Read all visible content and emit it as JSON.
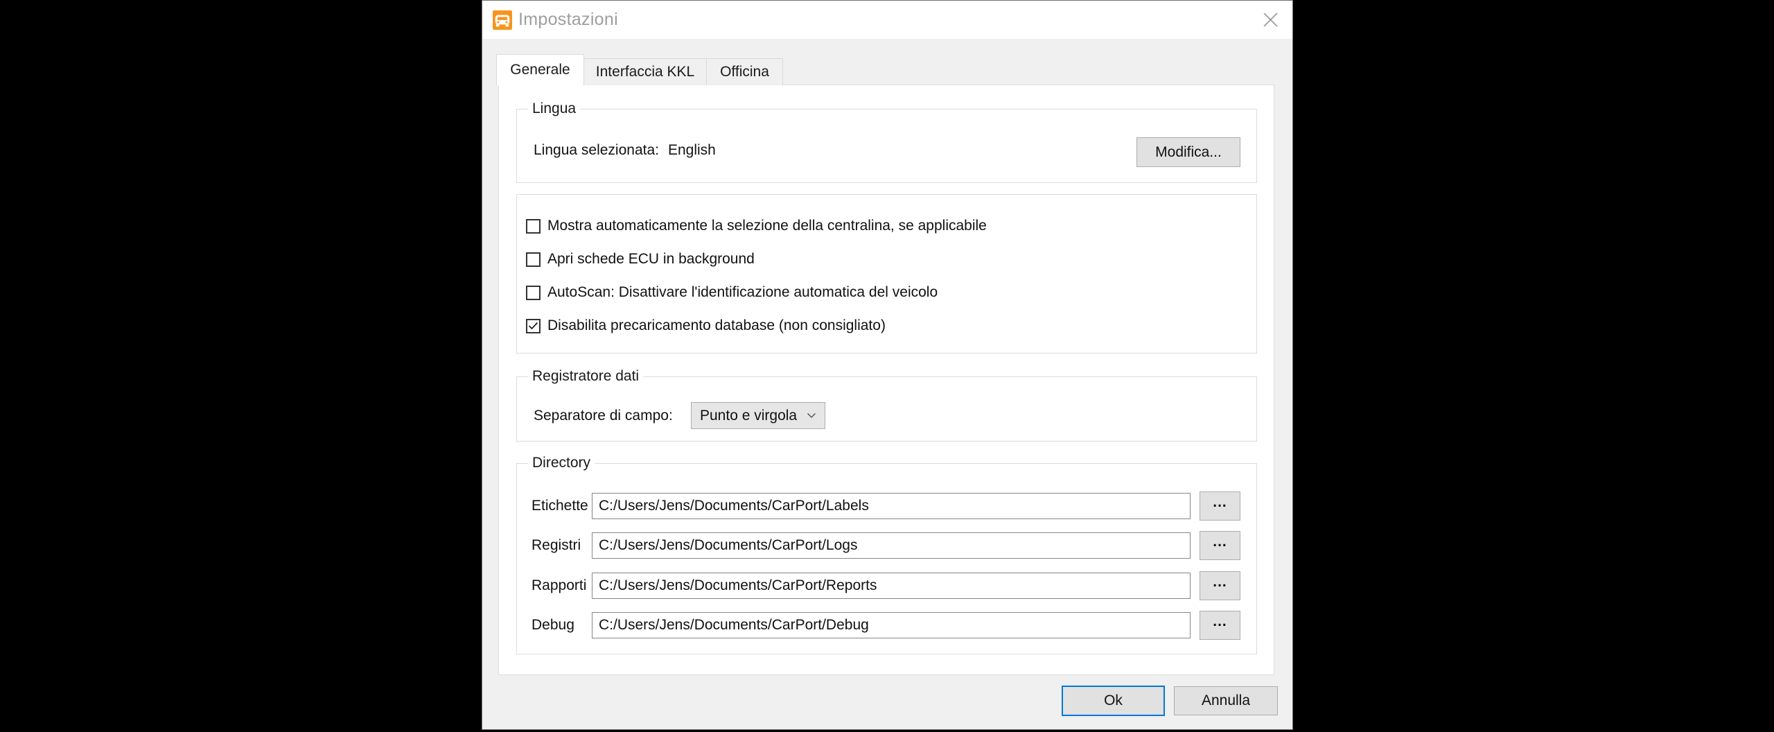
{
  "window": {
    "title": "Impostazioni"
  },
  "tabs": [
    {
      "label": "Generale",
      "active": true
    },
    {
      "label": "Interfaccia KKL",
      "active": false
    },
    {
      "label": "Officina",
      "active": false
    }
  ],
  "language": {
    "legend": "Lingua",
    "selected_label": "Lingua selezionata:",
    "selected_value": "English",
    "modify_button": "Modifica..."
  },
  "options": {
    "checkboxes": [
      {
        "label": "Mostra automaticamente la selezione della centralina, se applicabile",
        "checked": false
      },
      {
        "label": "Apri schede ECU in background",
        "checked": false
      },
      {
        "label": "AutoScan: Disattivare l'identificazione automatica del veicolo",
        "checked": false
      },
      {
        "label": "Disabilita precaricamento database (non consigliato)",
        "checked": true
      }
    ]
  },
  "data_logger": {
    "legend": "Registratore dati",
    "separator_label": "Separatore di campo:",
    "separator_value": "Punto e virgola"
  },
  "directories": {
    "legend": "Directory",
    "browse_button": "...",
    "rows": [
      {
        "label": "Etichette",
        "path": "C:/Users/Jens/Documents/CarPort/Labels"
      },
      {
        "label": "Registri",
        "path": "C:/Users/Jens/Documents/CarPort/Logs"
      },
      {
        "label": "Rapporti",
        "path": "C:/Users/Jens/Documents/CarPort/Reports"
      },
      {
        "label": "Debug",
        "path": "C:/Users/Jens/Documents/CarPort/Debug"
      }
    ]
  },
  "footer": {
    "ok": "Ok",
    "cancel": "Annulla"
  },
  "colors": {
    "accent_orange": "#F7941E",
    "focus_blue": "#0078D7",
    "dialog_bg": "#F0F0F0",
    "button_bg": "#E1E1E1",
    "button_border": "#ADADAD",
    "group_border": "#DCDCDC",
    "title_text": "#9E9E9E"
  }
}
